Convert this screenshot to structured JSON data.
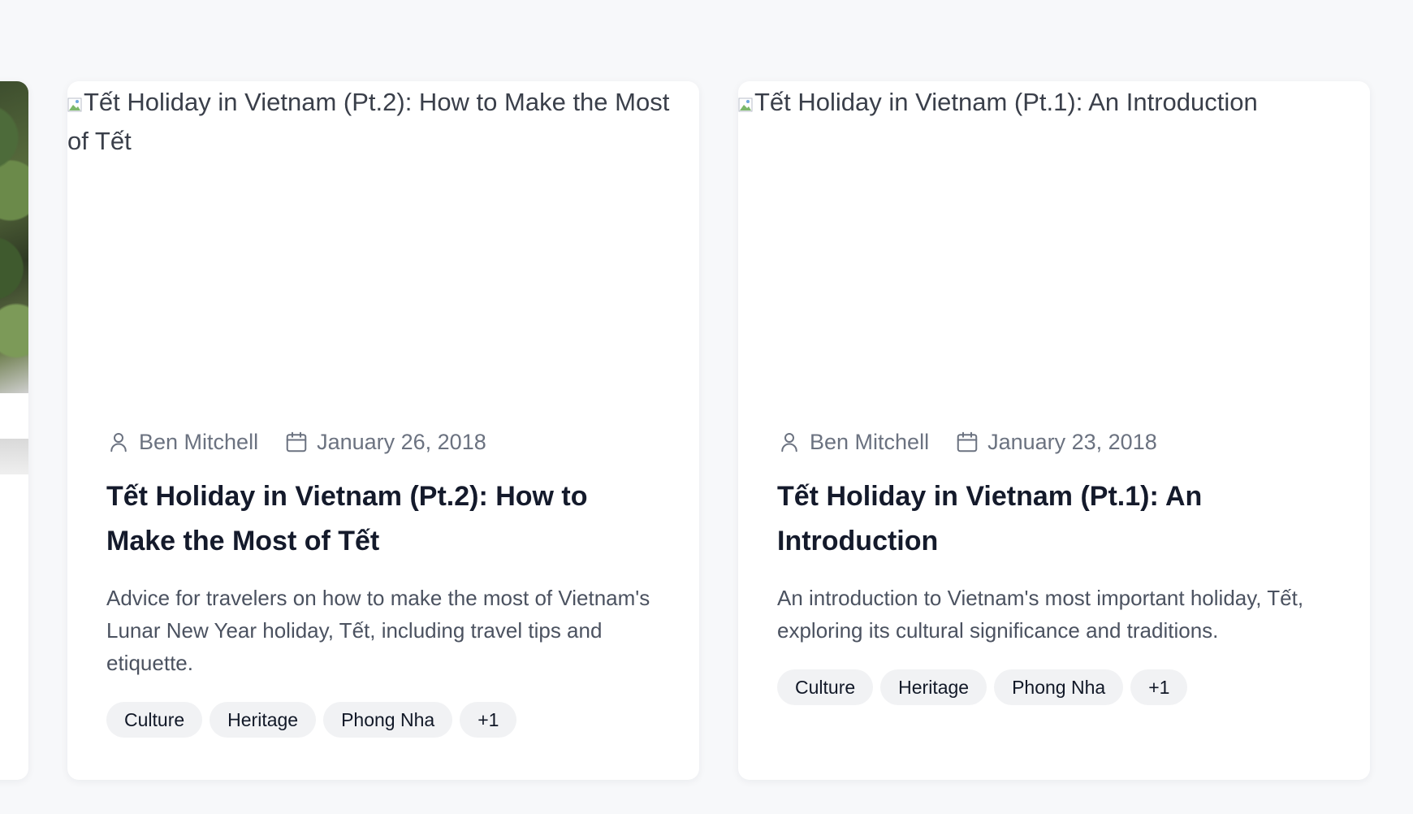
{
  "cards": [
    {
      "image_alt": "Tết Holiday in Vietnam (Pt.2): How to Make the Most of Tết",
      "author": "Ben Mitchell",
      "date": "January 26, 2018",
      "title": "Tết Holiday in Vietnam (Pt.2): How to Make the Most of Tết",
      "description": "Advice for travelers on how to make the most of Vietnam's Lunar New Year holiday, Tết, including travel tips and etiquette.",
      "tags": [
        "Culture",
        "Heritage",
        "Phong Nha",
        "+1"
      ]
    },
    {
      "image_alt": "Tết Holiday in Vietnam (Pt.1): An Introduction",
      "author": "Ben Mitchell",
      "date": "January 23, 2018",
      "title": "Tết Holiday in Vietnam (Pt.1): An Introduction",
      "description": "An introduction to Vietnam's most important holiday, Tết, exploring its cultural significance and traditions.",
      "tags": [
        "Culture",
        "Heritage",
        "Phong Nha",
        "+1"
      ]
    }
  ],
  "icons": {
    "author": "user-icon",
    "date": "calendar-icon",
    "broken_image": "broken-image-icon"
  }
}
